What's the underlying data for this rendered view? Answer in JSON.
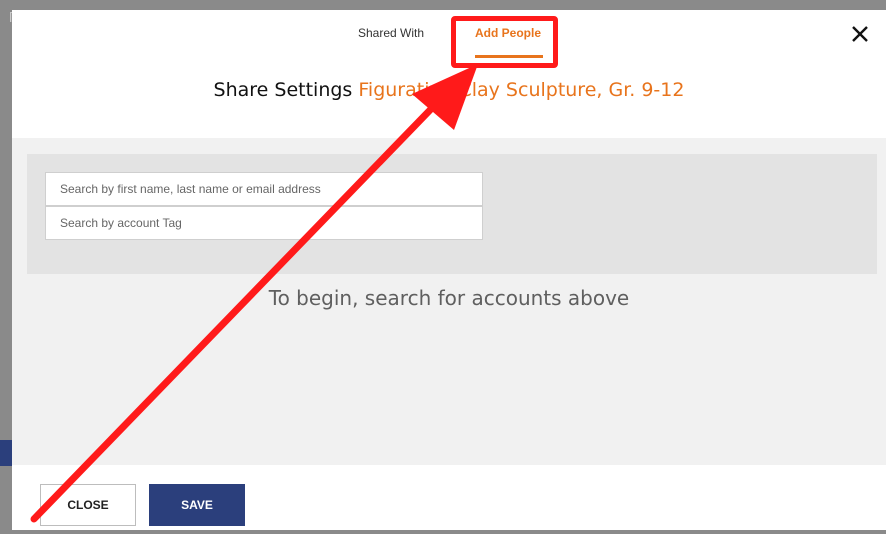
{
  "tabs": {
    "shared_with": "Shared With",
    "add_people": "Add People"
  },
  "title": {
    "prefix": "Share Settings",
    "item_name": "Figurative Clay Sculpture, Gr. 9-12"
  },
  "search": {
    "name_placeholder": "Search by first name, last name or email address",
    "tag_placeholder": "Search by account Tag"
  },
  "empty_message": "To begin, search for accounts above",
  "footer": {
    "close_label": "CLOSE",
    "save_label": "SAVE"
  },
  "icons": {
    "close": "close-icon"
  },
  "colors": {
    "accent": "#e8741c",
    "save_button": "#2b3f7c",
    "annotation": "#ff1a1a"
  }
}
